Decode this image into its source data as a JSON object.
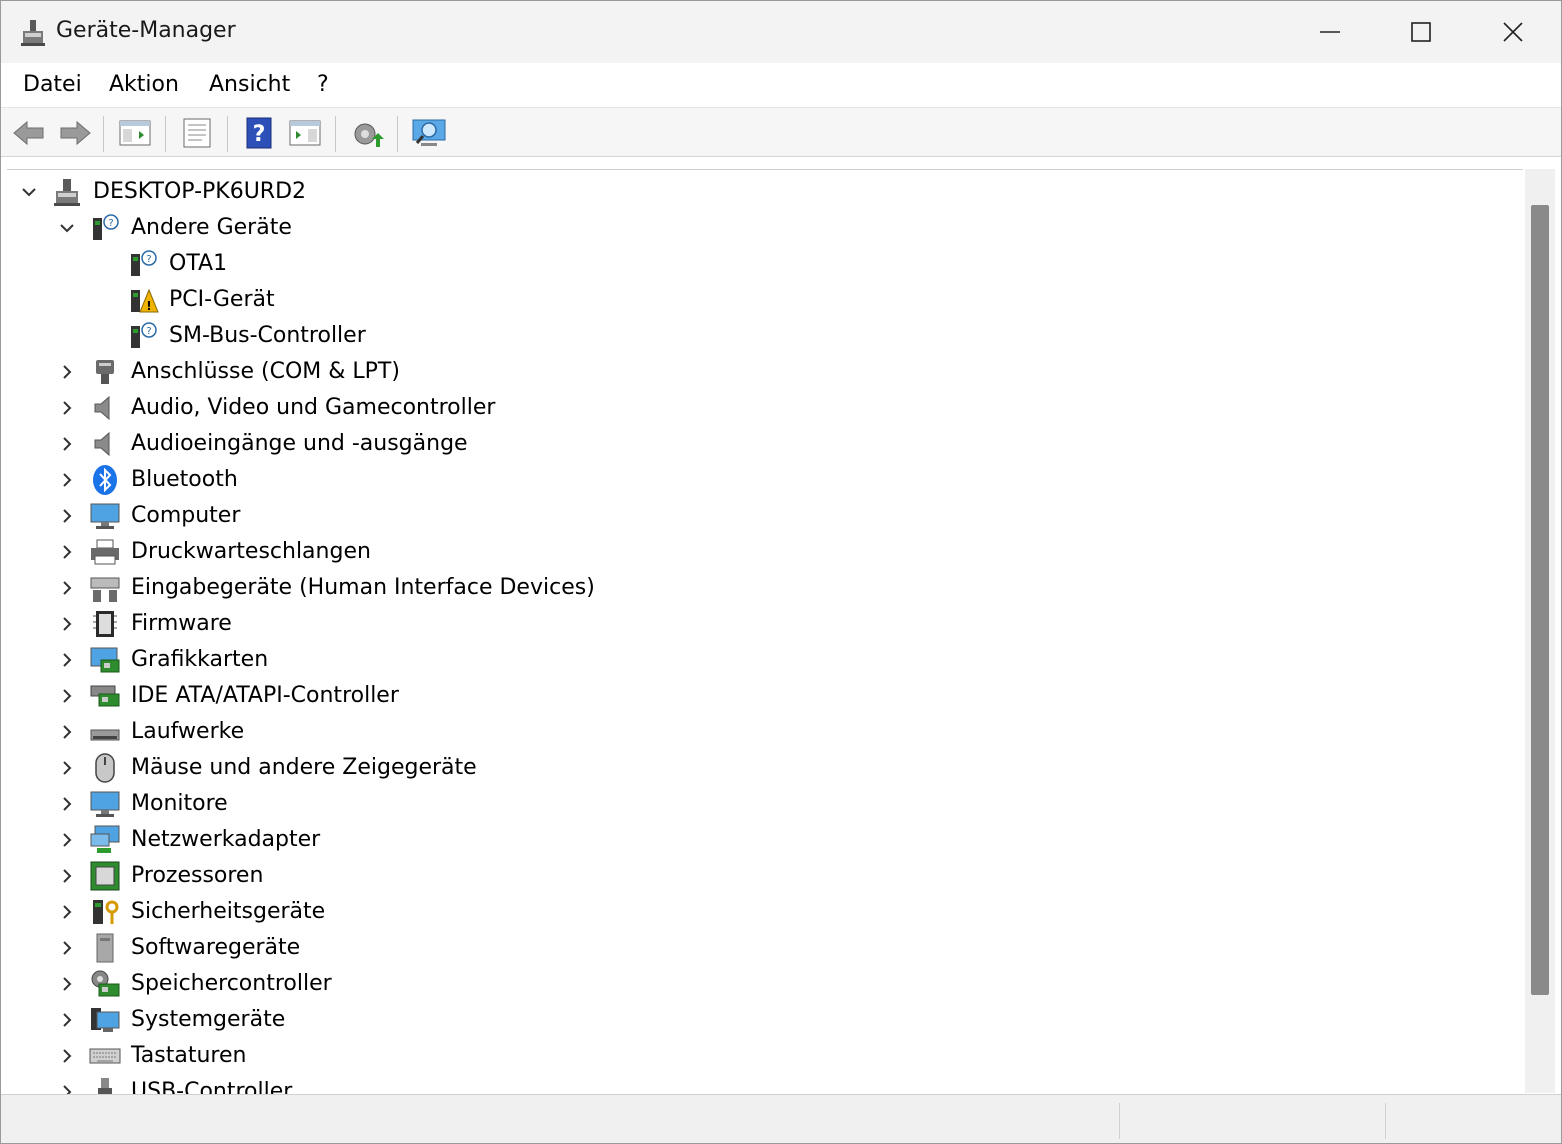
{
  "window": {
    "title": "Geräte-Manager",
    "minimize_glyph": "—",
    "maximize_glyph": "☐",
    "close_glyph": "✕"
  },
  "menu": {
    "items": [
      "Datei",
      "Aktion",
      "Ansicht",
      "?"
    ]
  },
  "toolbar": {
    "buttons": [
      "back-arrow-icon",
      "forward-arrow-icon",
      "show-hide-console-tree-icon",
      "properties-icon",
      "help-icon",
      "show-action-pane-icon",
      "update-driver-icon",
      "scan-hardware-icon"
    ]
  },
  "tree": {
    "root": "DESKTOP-PK6URD2",
    "other_devices": {
      "label": "Andere Geräte",
      "children": [
        "OTA1",
        "PCI-Gerät",
        "SM-Bus-Controller"
      ]
    },
    "categories": [
      "Anschlüsse (COM & LPT)",
      "Audio, Video und Gamecontroller",
      "Audioeingänge und -ausgänge",
      "Bluetooth",
      "Computer",
      "Druckwarteschlangen",
      "Eingabegeräte (Human Interface Devices)",
      "Firmware",
      "Grafikkarten",
      "IDE ATA/ATAPI-Controller",
      "Laufwerke",
      "Mäuse und andere Zeigegeräte",
      "Monitore",
      "Netzwerkadapter",
      "Prozessoren",
      "Sicherheitsgeräte",
      "Softwaregeräte",
      "Speichercontroller",
      "Systemgeräte",
      "Tastaturen",
      "USB-Controller"
    ]
  },
  "colors": {
    "accent": "#1a73e8",
    "warning": "#f0b400",
    "scroll_thumb": "#8a8a8a"
  }
}
